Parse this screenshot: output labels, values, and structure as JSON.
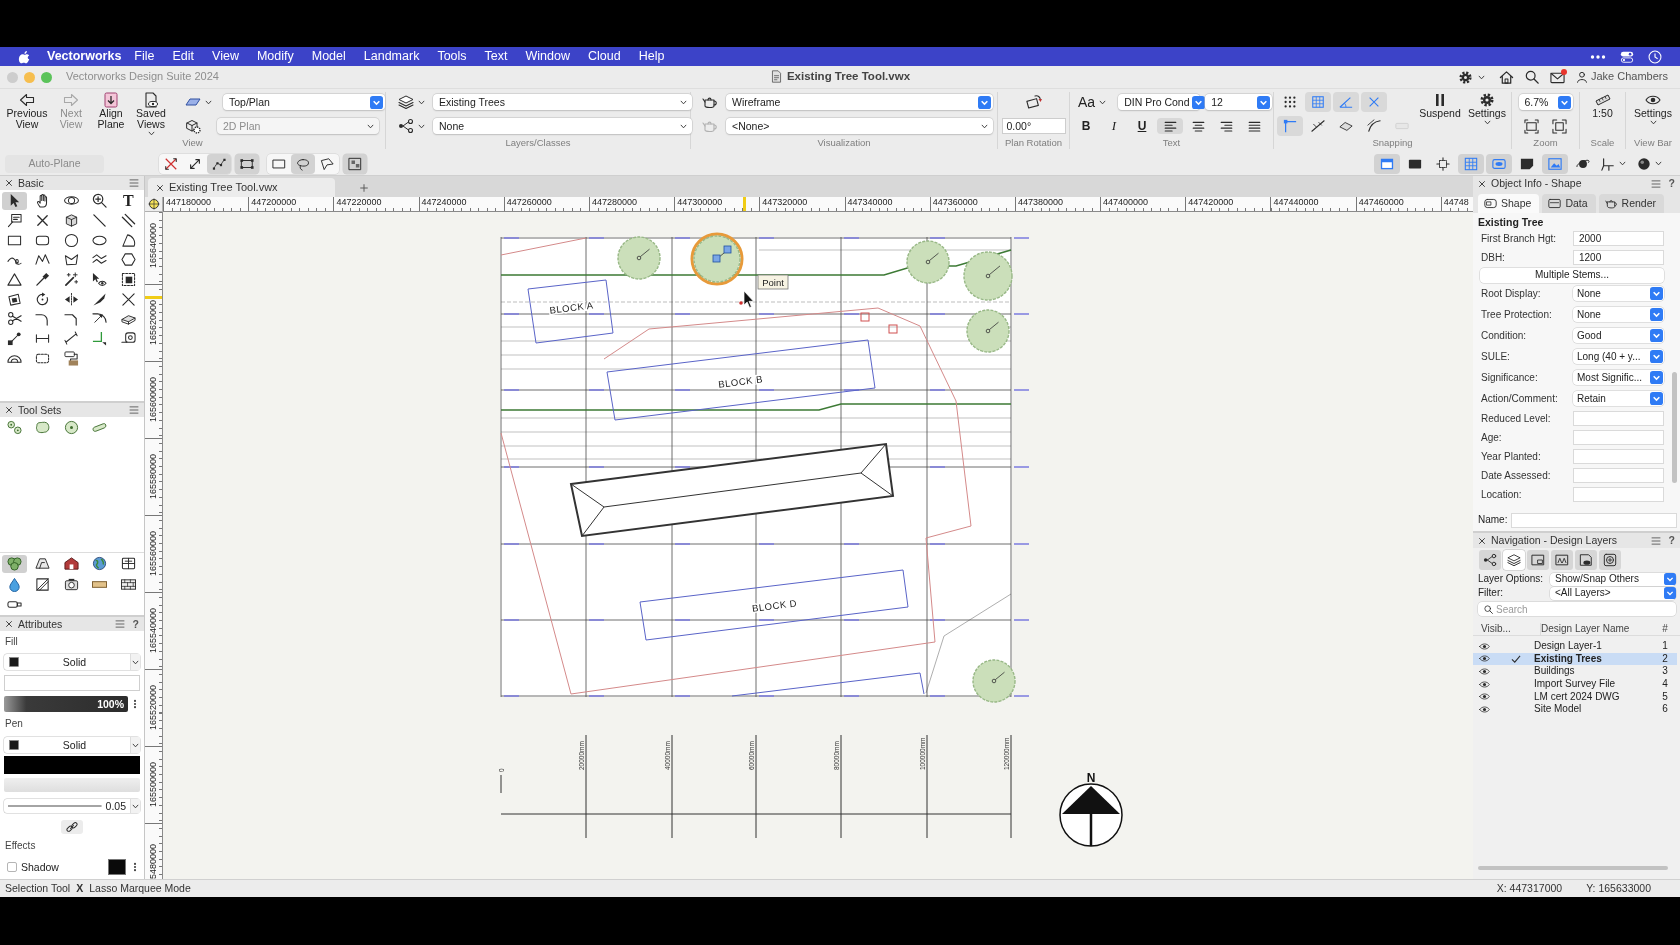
{
  "menu_bar": {
    "app_name": "Vectorworks",
    "items": [
      "File",
      "Edit",
      "View",
      "Modify",
      "Model",
      "Landmark",
      "Tools",
      "Text",
      "Window",
      "Cloud",
      "Help"
    ]
  },
  "window": {
    "app_title": "Vectorworks Design Suite 2024",
    "title": "Existing Tree Tool.vwx",
    "user": "Jake Chambers",
    "mail_unread": true
  },
  "toolbar": {
    "view": {
      "label": "View",
      "buttons": [
        {
          "kind": "back",
          "label": "Previous View",
          "disabled": false
        },
        {
          "kind": "forward",
          "label": "Next View",
          "disabled": true
        },
        {
          "kind": "align-plane",
          "label": "Align Plane",
          "disabled": false
        },
        {
          "kind": "saved-views",
          "label": "Saved Views",
          "disabled": false
        }
      ],
      "projection": "Top/Plan",
      "render_mode": "2D Plan",
      "render_mode_disabled": true
    },
    "layers_classes": {
      "label": "Layers/Classes",
      "layer": "Existing Trees",
      "class": "None"
    },
    "visualization": {
      "label": "Visualization",
      "mode": "Wireframe",
      "saved_view": "<None>",
      "saved_view_icon_disabled": true
    },
    "plan_rotation": {
      "label": "Plan Rotation",
      "value": "0.00°"
    },
    "text": {
      "label": "Text",
      "glyph": "Aa",
      "font": "DIN Pro Cond",
      "size": "12",
      "styles": [
        {
          "kind": "bold",
          "label": "B"
        },
        {
          "kind": "italic",
          "label": "I"
        },
        {
          "kind": "underline",
          "label": "U"
        }
      ],
      "alignments": [
        {
          "kind": "left",
          "selected": true
        },
        {
          "kind": "center",
          "selected": false
        },
        {
          "kind": "right",
          "selected": false
        },
        {
          "kind": "justify",
          "selected": false
        }
      ]
    },
    "snapping": {
      "label": "Snapping",
      "modes": [
        {
          "kind": "dot-grid",
          "selected": false,
          "disabled": false
        },
        {
          "kind": "box-grid",
          "selected": true,
          "disabled": false
        },
        {
          "kind": "angle",
          "selected": true,
          "disabled": false
        },
        {
          "kind": "x-snap",
          "selected": true,
          "disabled": false
        },
        {
          "kind": "corner",
          "selected": true,
          "disabled": false
        },
        {
          "kind": "line-snap",
          "selected": false,
          "disabled": false
        },
        {
          "kind": "surface",
          "selected": false,
          "disabled": false
        },
        {
          "kind": "tangent",
          "selected": false,
          "disabled": false
        },
        {
          "kind": "distance",
          "selected": false,
          "disabled": true
        }
      ],
      "suspend": "Suspend",
      "settings": "Settings"
    },
    "zoom": {
      "label": "Zoom",
      "value": "6.7%"
    },
    "scale": {
      "label": "Scale",
      "value": "1:50"
    },
    "view_bar": {
      "label": "View Bar",
      "settings": "Settings"
    }
  },
  "mode_bar": {
    "auto_plane": "Auto-Plane",
    "auto_plane_disabled": true,
    "modes": [
      {
        "kind": "ortho-arrows",
        "selected": false
      },
      {
        "kind": "diagonal-arrow",
        "selected": false
      },
      {
        "kind": "node-path",
        "selected": true
      },
      {
        "kind": "transform-box",
        "selected": true
      },
      {
        "kind": "rectangle-marquee",
        "selected": false
      },
      {
        "kind": "lasso",
        "selected": true
      },
      {
        "kind": "polygon-lasso",
        "selected": false
      },
      {
        "kind": "group-box",
        "selected": true
      }
    ]
  },
  "view_bar_tools": [
    {
      "kind": "layout-panel",
      "selected": true
    },
    {
      "kind": "filled-rectangle",
      "selected": false
    },
    {
      "kind": "dotted-frame",
      "selected": false
    },
    {
      "kind": "grid-frame",
      "selected": true
    },
    {
      "kind": "eye-frame",
      "selected": true
    },
    {
      "kind": "sticky-note",
      "selected": false
    },
    {
      "kind": "image-frame",
      "selected": true
    },
    {
      "kind": "planet",
      "selected": false
    },
    {
      "kind": "axis-frame",
      "selected": false
    },
    {
      "kind": "render-ball",
      "selected": false
    }
  ],
  "basic_palette": {
    "title": "Basic",
    "tools": [
      {
        "kind": "pointer",
        "selected": true
      },
      {
        "kind": "hand",
        "selected": false
      },
      {
        "kind": "orbit",
        "selected": false
      },
      {
        "kind": "zoom",
        "selected": false
      },
      {
        "kind": "text",
        "glyph": "T",
        "selected": false
      },
      {
        "kind": "callout",
        "selected": false
      },
      {
        "kind": "x-mark",
        "selected": false
      },
      {
        "kind": "cube",
        "selected": false
      },
      {
        "kind": "line",
        "selected": false
      },
      {
        "kind": "double-line",
        "selected": false
      },
      {
        "kind": "rectangle",
        "selected": false
      },
      {
        "kind": "rounded-rectangle",
        "selected": false
      },
      {
        "kind": "circle",
        "selected": false
      },
      {
        "kind": "oval",
        "selected": false
      },
      {
        "kind": "pie-slice",
        "selected": false
      },
      {
        "kind": "loop-curve",
        "selected": false
      },
      {
        "kind": "polyline",
        "selected": false
      },
      {
        "kind": "polygon",
        "selected": false
      },
      {
        "kind": "double-polyline",
        "selected": false
      },
      {
        "kind": "hexagon",
        "selected": false
      },
      {
        "kind": "triangle",
        "selected": false
      },
      {
        "kind": "eyedropper",
        "selected": false
      },
      {
        "kind": "magic-wand",
        "selected": false
      },
      {
        "kind": "pointer-eye",
        "selected": false
      },
      {
        "kind": "nested-squares",
        "selected": false
      },
      {
        "kind": "skewed-square",
        "selected": false
      },
      {
        "kind": "rotate-arrow",
        "selected": false
      },
      {
        "kind": "mirror",
        "selected": false
      },
      {
        "kind": "knife",
        "selected": false
      },
      {
        "kind": "crossed-lines",
        "selected": false
      },
      {
        "kind": "scissors",
        "selected": false
      },
      {
        "kind": "rounded-corner",
        "selected": false
      },
      {
        "kind": "chamfer-corner",
        "selected": false
      },
      {
        "kind": "offset-arrow",
        "selected": false
      },
      {
        "kind": "slab",
        "selected": false
      },
      {
        "kind": "linked-nodes",
        "selected": false
      },
      {
        "kind": "dimension-line",
        "selected": false
      },
      {
        "kind": "angled-dimension",
        "selected": false
      },
      {
        "kind": "axes",
        "selected": false
      },
      {
        "kind": "tape-measure",
        "selected": false
      },
      {
        "kind": "protractor",
        "selected": false
      },
      {
        "kind": "dashed-rectangle",
        "selected": false
      },
      {
        "kind": "paint-roller",
        "selected": false
      }
    ]
  },
  "tool_sets": {
    "title": "Tool Sets",
    "sets": [
      {
        "kind": "tree-cluster",
        "selected": true
      },
      {
        "kind": "terrain",
        "selected": false
      },
      {
        "kind": "barn",
        "selected": false
      },
      {
        "kind": "globe",
        "selected": false
      },
      {
        "kind": "grid-panel",
        "selected": false
      },
      {
        "kind": "water-drop",
        "selected": false
      },
      {
        "kind": "diagonal-square",
        "selected": false
      },
      {
        "kind": "camera",
        "selected": false
      },
      {
        "kind": "beam",
        "selected": false
      },
      {
        "kind": "wall-block",
        "selected": false
      },
      {
        "kind": "pipe",
        "selected": false
      }
    ]
  },
  "attributes": {
    "title": "Attributes",
    "help": "?",
    "fill_label": "Fill",
    "fill_style": "Solid",
    "fill_opacity": {
      "reading": "100%",
      "level": 1
    },
    "pen_label": "Pen",
    "pen_style": "Solid",
    "line_weight": "0.05",
    "effects_label": "Effects",
    "shadow": {
      "label": "Shadow",
      "checked": false
    }
  },
  "document_tabs": [
    {
      "title": "Existing Tree Tool.vwx",
      "selected": true
    }
  ],
  "rulers": {
    "x_labels": [
      "447180000",
      "447200000",
      "447220000",
      "447240000",
      "447260000",
      "447280000",
      "447300000",
      "447320000",
      "447340000",
      "447360000",
      "447380000",
      "447400000",
      "447420000",
      "447440000",
      "447460000",
      "44748"
    ],
    "y_labels": [
      "165640000",
      "165620000",
      "165600000",
      "165580000",
      "165560000",
      "165540000",
      "165520000",
      "165500000",
      "5480000"
    ]
  },
  "plan": {
    "blocks": [
      {
        "label": "BLOCK A"
      },
      {
        "label": "BLOCK B"
      },
      {
        "label": "BLOCK D"
      }
    ],
    "trees": [
      {
        "selected": false
      },
      {
        "selected": true
      },
      {
        "selected": false
      },
      {
        "selected": false
      },
      {
        "selected": false
      },
      {
        "selected": false
      }
    ],
    "tooltip": "Point",
    "scale_labels": [
      "0",
      "20000mm",
      "40000mm",
      "60000mm",
      "80000mm",
      "100000mm",
      "120000mm"
    ],
    "north_label": "N"
  },
  "object_info": {
    "title": "Object Info - Shape",
    "help": "?",
    "tabs": [
      {
        "kind": "shape",
        "label": "Shape",
        "selected": true
      },
      {
        "kind": "data",
        "label": "Data",
        "selected": false
      },
      {
        "kind": "render",
        "label": "Render",
        "selected": false
      }
    ],
    "heading": "Existing Tree",
    "fields": [
      {
        "kind": "text",
        "label": "First Branch Hgt:",
        "value": "2000"
      },
      {
        "kind": "text",
        "label": "DBH:",
        "value": "1200"
      },
      {
        "kind": "button",
        "label": "Multiple Stems..."
      },
      {
        "kind": "select",
        "label": "Root Display:",
        "value": "None"
      },
      {
        "kind": "select",
        "label": "Tree Protection:",
        "value": "None"
      },
      {
        "kind": "select",
        "label": "Condition:",
        "value": "Good"
      },
      {
        "kind": "select",
        "label": "SULE:",
        "value": "Long (40 + y..."
      },
      {
        "kind": "select",
        "label": "Significance:",
        "value": "Most Signific..."
      },
      {
        "kind": "select",
        "label": "Action/Comment:",
        "value": "Retain"
      },
      {
        "kind": "text",
        "label": "Reduced Level:"
      },
      {
        "kind": "text",
        "label": "Age:"
      },
      {
        "kind": "text",
        "label": "Year Planted:"
      },
      {
        "kind": "text",
        "label": "Date Assessed:"
      },
      {
        "kind": "text",
        "label": "Location:"
      }
    ],
    "name_label": "Name:"
  },
  "navigation": {
    "title": "Navigation - Design Layers",
    "help": "?",
    "views": [
      {
        "kind": "node-graph",
        "selected": false
      },
      {
        "kind": "layers-stack",
        "selected": true
      },
      {
        "kind": "sheet",
        "selected": false
      },
      {
        "kind": "frame-figures",
        "selected": false
      },
      {
        "kind": "viewport",
        "selected": false
      },
      {
        "kind": "reference",
        "selected": false
      }
    ],
    "layer_options_label": "Layer Options:",
    "layer_options": "Show/Snap Others",
    "filter_label": "Filter:",
    "filter": "<All Layers>",
    "search_placeholder": "Search",
    "columns": [
      "Visib...",
      "Design Layer Name",
      "#"
    ],
    "layers": [
      {
        "name": "Design Layer-1",
        "number": "1",
        "visible": true,
        "active": false,
        "selected": false
      },
      {
        "name": "Existing Trees",
        "number": "2",
        "visible": true,
        "active": true,
        "selected": true
      },
      {
        "name": "Buildings",
        "number": "3",
        "visible": true,
        "active": false,
        "selected": false
      },
      {
        "name": "Import Survey File",
        "number": "4",
        "visible": true,
        "active": false,
        "selected": false
      },
      {
        "name": "LM cert 2024 DWG",
        "number": "5",
        "visible": true,
        "active": false,
        "selected": false
      },
      {
        "name": "Site Model",
        "number": "6",
        "visible": true,
        "active": false,
        "selected": false
      }
    ]
  },
  "status_bar": {
    "tool": "Selection Tool",
    "mode_glyph": "X",
    "mode": "Lasso Marquee Mode",
    "x": "X: 447317000",
    "y": "Y: 165633000"
  }
}
